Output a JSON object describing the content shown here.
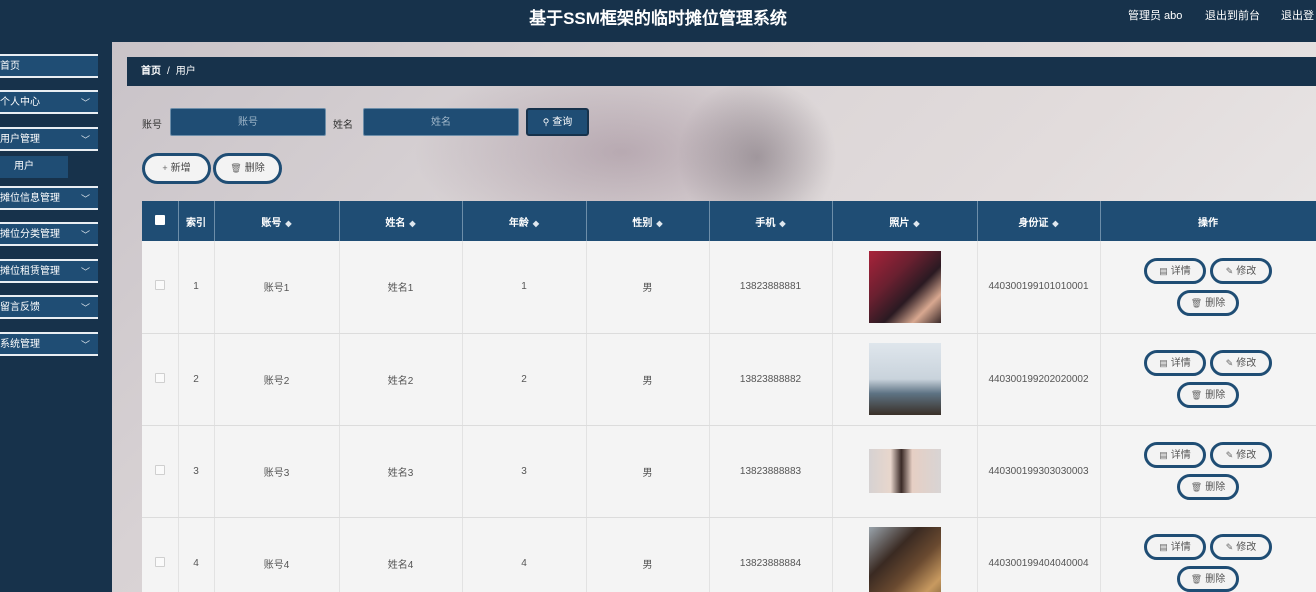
{
  "header": {
    "title": "基于SSM框架的临时摊位管理系统",
    "admin": "管理员 abo",
    "back_to_front": "退出到前台",
    "logout": "退出登"
  },
  "sidebar": {
    "items": [
      {
        "label": "首页"
      },
      {
        "label": "个人中心"
      },
      {
        "label": "用户管理"
      },
      {
        "label": "摊位信息管理"
      },
      {
        "label": "摊位分类管理"
      },
      {
        "label": "摊位租赁管理"
      },
      {
        "label": "留言反馈"
      },
      {
        "label": "系统管理"
      }
    ],
    "subitem": "用户"
  },
  "breadcrumb": {
    "home": "首页",
    "sep": "/",
    "current": "用户"
  },
  "search": {
    "account_label": "账号",
    "account_placeholder": "账号",
    "name_label": "姓名",
    "name_placeholder": "姓名",
    "query_label": "查询"
  },
  "actions": {
    "add": "新增",
    "delete": "删除"
  },
  "table": {
    "headers": [
      "索引",
      "账号",
      "姓名",
      "年龄",
      "性别",
      "手机",
      "照片",
      "身份证",
      "操作"
    ],
    "rows": [
      {
        "index": "1",
        "account": "账号1",
        "name": "姓名1",
        "age": "1",
        "gender": "男",
        "phone": "13823888881",
        "id_card": "440300199101010001"
      },
      {
        "index": "2",
        "account": "账号2",
        "name": "姓名2",
        "age": "2",
        "gender": "男",
        "phone": "13823888882",
        "id_card": "440300199202020002"
      },
      {
        "index": "3",
        "account": "账号3",
        "name": "姓名3",
        "age": "3",
        "gender": "男",
        "phone": "13823888883",
        "id_card": "440300199303030003"
      },
      {
        "index": "4",
        "account": "账号4",
        "name": "姓名4",
        "age": "4",
        "gender": "男",
        "phone": "13823888884",
        "id_card": "440300199404040004"
      }
    ],
    "row_actions": {
      "detail": "详情",
      "edit": "修改",
      "delete": "删除"
    }
  },
  "colors": {
    "navy": "#17324b",
    "blue": "#1f4d74"
  }
}
